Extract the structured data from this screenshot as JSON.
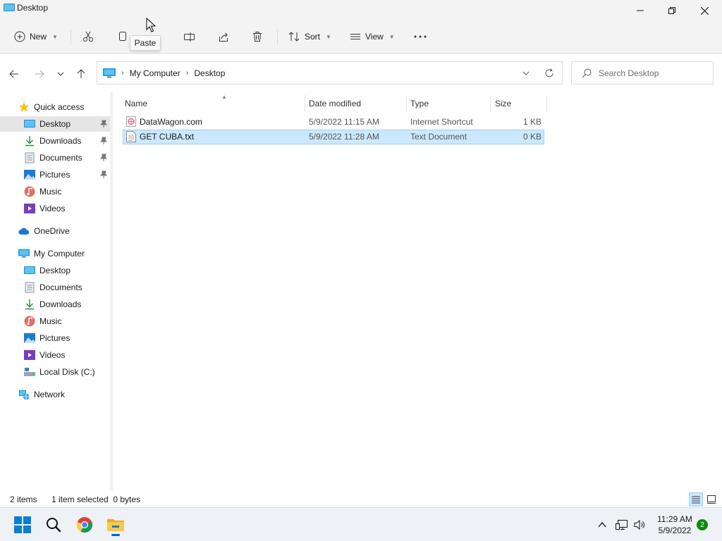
{
  "window": {
    "title": "Desktop"
  },
  "toolbar": {
    "new_label": "New",
    "sort_label": "Sort",
    "view_label": "View",
    "tooltip": "Paste"
  },
  "address": {
    "crumbs": [
      "My Computer",
      "Desktop"
    ],
    "search_placeholder": "Search Desktop"
  },
  "sidebar": {
    "quick_access": "Quick access",
    "quick_items": [
      {
        "label": "Desktop",
        "icon": "desktop-icon",
        "pinned": true,
        "selected": true
      },
      {
        "label": "Downloads",
        "icon": "download-icon",
        "pinned": true
      },
      {
        "label": "Documents",
        "icon": "documents-icon",
        "pinned": true
      },
      {
        "label": "Pictures",
        "icon": "pictures-icon",
        "pinned": true
      },
      {
        "label": "Music",
        "icon": "music-icon"
      },
      {
        "label": "Videos",
        "icon": "videos-icon"
      }
    ],
    "onedrive": "OneDrive",
    "computer": "My Computer",
    "computer_items": [
      {
        "label": "Desktop",
        "icon": "desktop-icon"
      },
      {
        "label": "Documents",
        "icon": "documents-icon"
      },
      {
        "label": "Downloads",
        "icon": "download-icon"
      },
      {
        "label": "Music",
        "icon": "music-icon"
      },
      {
        "label": "Pictures",
        "icon": "pictures-icon"
      },
      {
        "label": "Videos",
        "icon": "videos-icon"
      },
      {
        "label": "Local Disk (C:)",
        "icon": "drive-icon"
      }
    ],
    "network": "Network"
  },
  "files": {
    "columns": [
      "Name",
      "Date modified",
      "Type",
      "Size"
    ],
    "rows": [
      {
        "name": "DataWagon.com",
        "date": "5/9/2022 11:15 AM",
        "type": "Internet Shortcut",
        "size": "1 KB",
        "icon": "internet-shortcut-icon",
        "selected": false
      },
      {
        "name": "GET CUBA.txt",
        "date": "5/9/2022 11:28 AM",
        "type": "Text Document",
        "size": "0 KB",
        "icon": "text-file-icon",
        "selected": true
      }
    ]
  },
  "status": {
    "item_count": "2 items",
    "selection": "1 item selected  0 bytes"
  },
  "taskbar": {
    "time": "11:29 AM",
    "date": "5/9/2022",
    "notifications": "2"
  },
  "colors": {
    "accent": "#0067c0",
    "selection_bg": "#cce8ff",
    "selection_border": "#99d1ff"
  }
}
